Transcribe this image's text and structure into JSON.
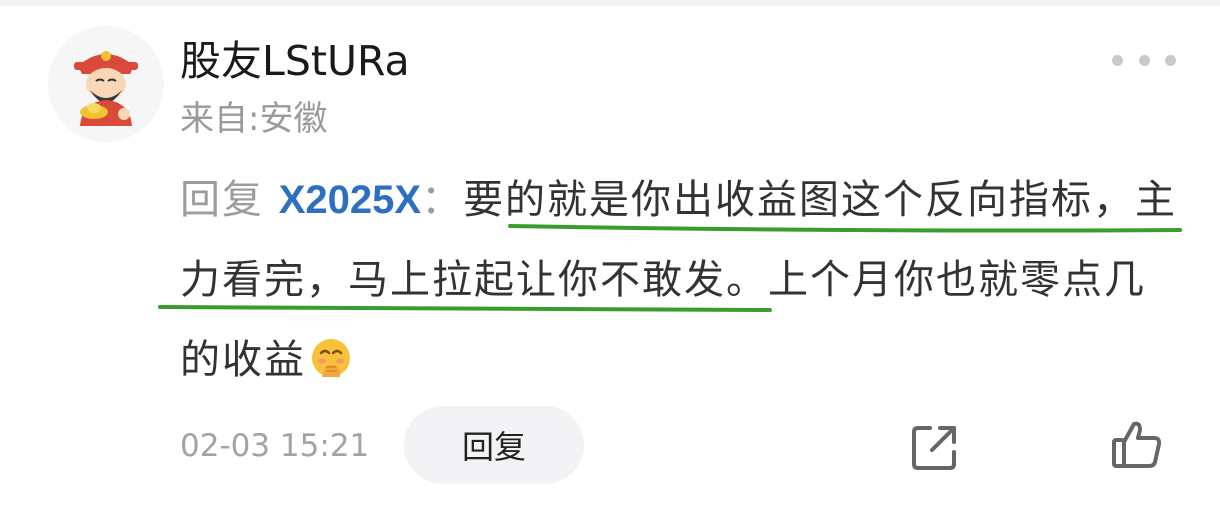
{
  "comment": {
    "username": "股友LStURa",
    "location": "来自:安徽",
    "reply_prefix": "回复",
    "mention": "X2025X",
    "colon": "：",
    "text": "要的就是你出收益图这个反向指标，主力看完，马上拉起让你不敢发。上个月你也就零点几的收益",
    "timestamp": "02-03 15:21",
    "reply_button_label": "回复"
  },
  "icons": {
    "more": "more-horizontal-icon",
    "emoji": "snickering-face-emoji-icon",
    "share": "share-icon",
    "like": "thumbs-up-icon",
    "avatar": "god-of-wealth-avatar"
  },
  "colors": {
    "mention": "#2f6fc0",
    "underline_annotation": "#3a9c2e",
    "secondary_text": "#9a9a9a",
    "reply_button_bg": "#f3f3f5"
  }
}
